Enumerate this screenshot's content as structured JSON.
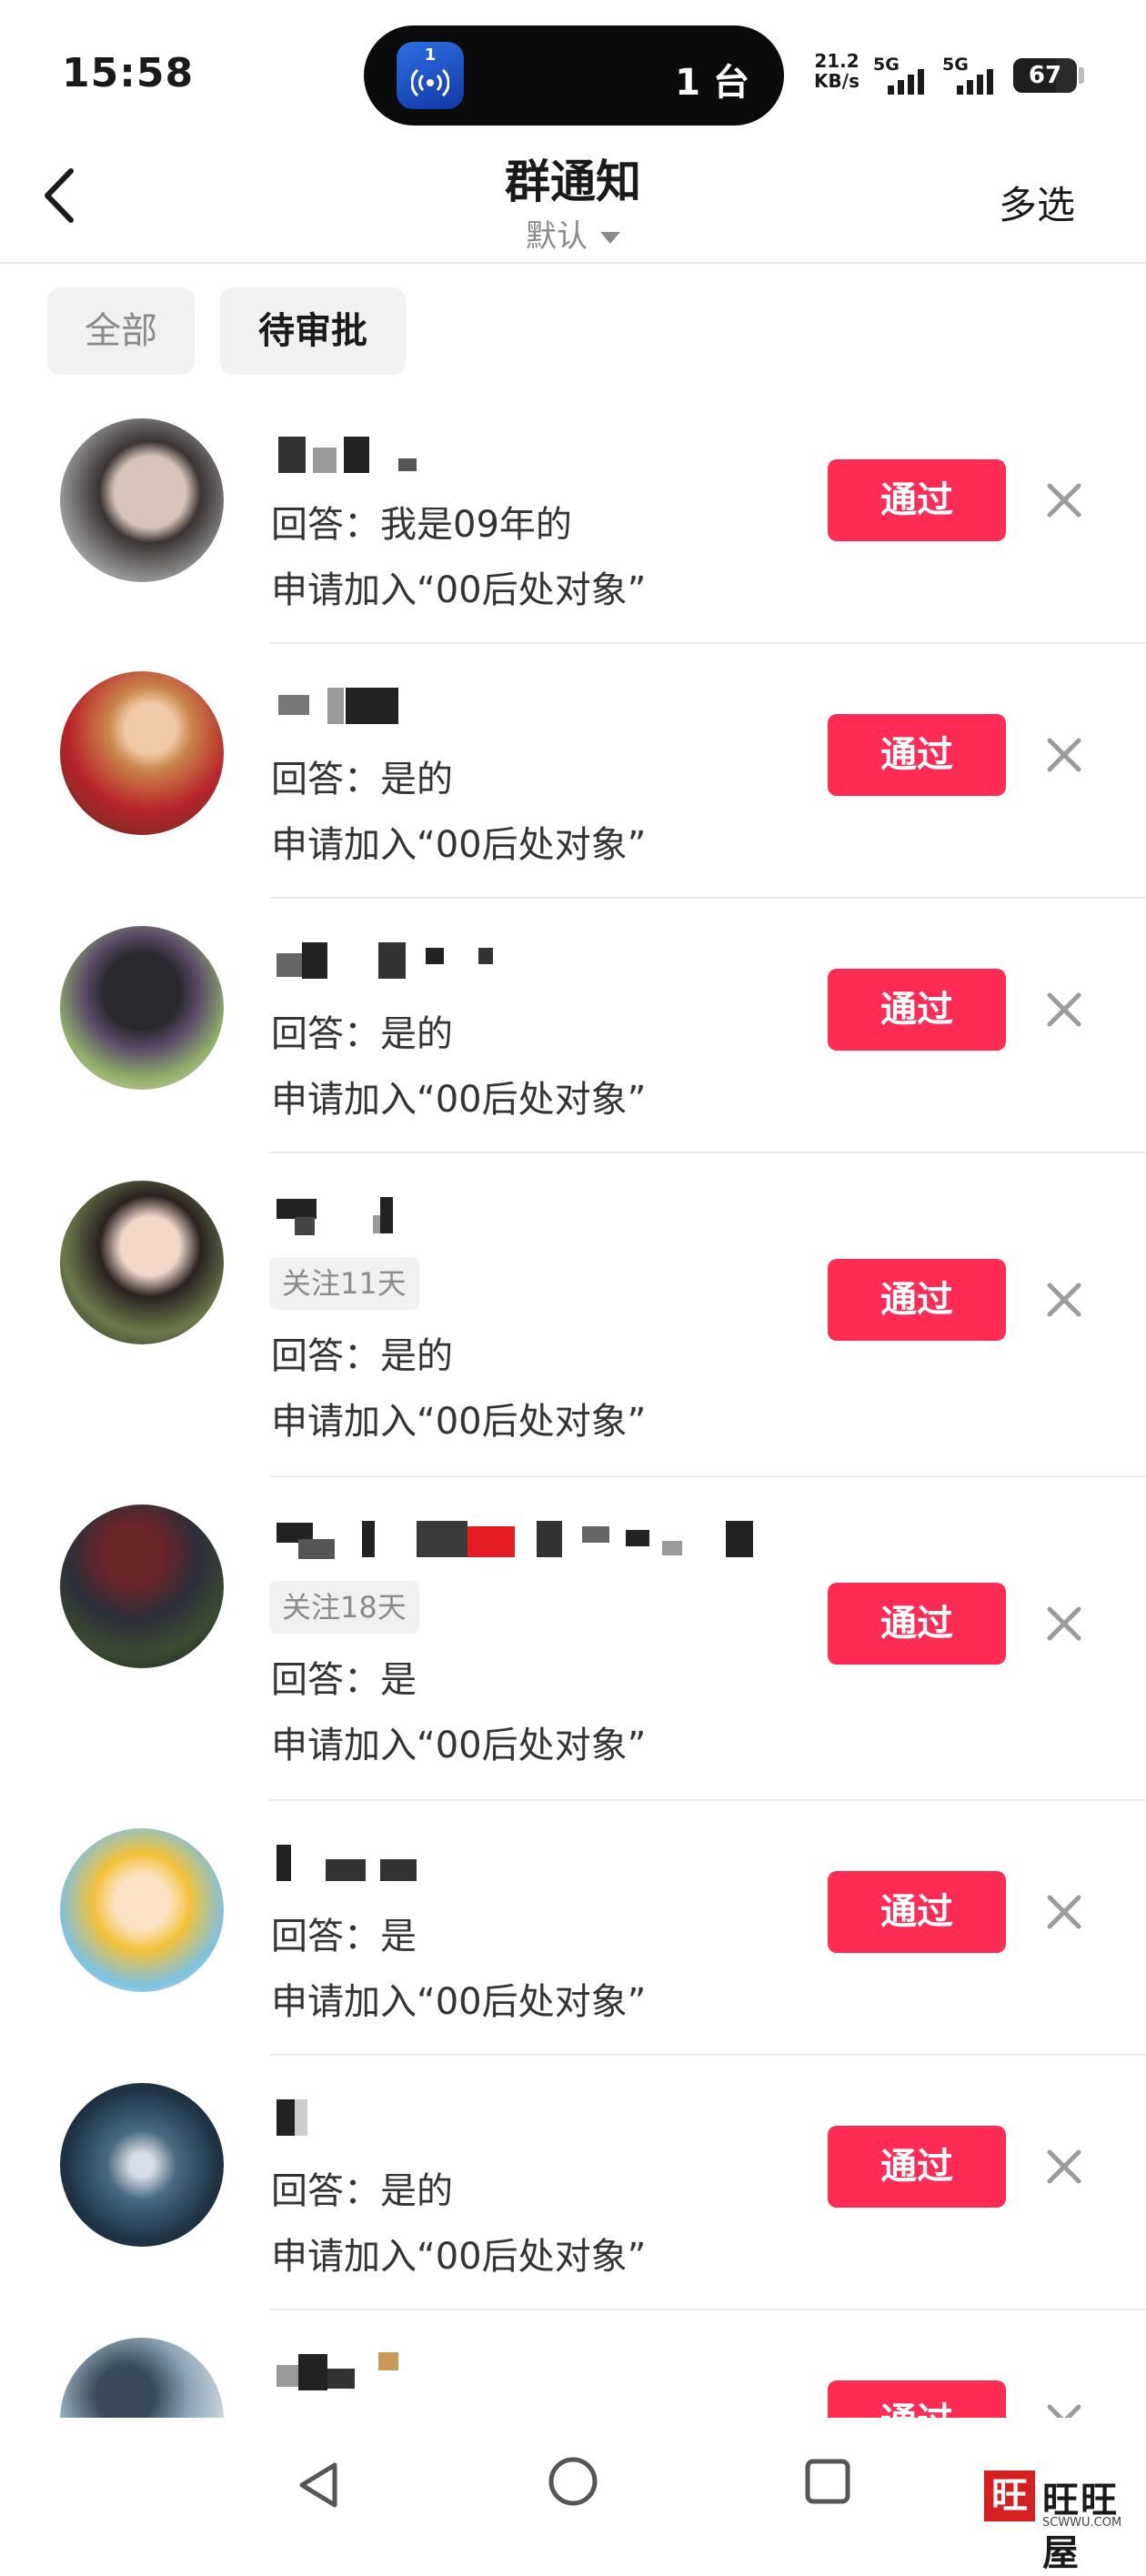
{
  "status_bar": {
    "time": "15:58",
    "island_badge": "1",
    "island_count": "1 台",
    "net_speed_value": "21.2",
    "net_speed_unit": "KB/s",
    "signal_1": "5G",
    "signal_2": "5G",
    "battery": "67"
  },
  "header": {
    "title": "群通知",
    "subtitle": "默认",
    "multi_select": "多选"
  },
  "filters": [
    {
      "label": "全部",
      "selected": false
    },
    {
      "label": "待审批",
      "selected": true
    }
  ],
  "requests": [
    {
      "follow_tag": "",
      "answer": "回答：我是09年的",
      "apply": "申请加入“00后处对象”",
      "approve": "通过"
    },
    {
      "follow_tag": "",
      "answer": "回答：是的",
      "apply": "申请加入“00后处对象”",
      "approve": "通过"
    },
    {
      "follow_tag": "",
      "answer": "回答：是的",
      "apply": "申请加入“00后处对象”",
      "approve": "通过"
    },
    {
      "follow_tag": "关注11天",
      "answer": "回答：是的",
      "apply": "申请加入“00后处对象”",
      "approve": "通过"
    },
    {
      "follow_tag": "关注18天",
      "answer": "回答：是",
      "apply": "申请加入“00后处对象”",
      "approve": "通过"
    },
    {
      "follow_tag": "",
      "answer": "回答：是",
      "apply": "申请加入“00后处对象”",
      "approve": "通过"
    },
    {
      "follow_tag": "",
      "answer": "回答：是的",
      "apply": "申请加入“00后处对象”",
      "approve": "通过"
    },
    {
      "follow_tag": "",
      "answer": "",
      "apply": "",
      "approve": "通过"
    }
  ],
  "watermark": {
    "badge": "旺",
    "text": "旺旺屋",
    "url": "SCWWU.COM"
  },
  "colors": {
    "accent": "#fe2c55",
    "chip_bg": "#f1f1f1",
    "muted_text": "#8a8a8a"
  }
}
